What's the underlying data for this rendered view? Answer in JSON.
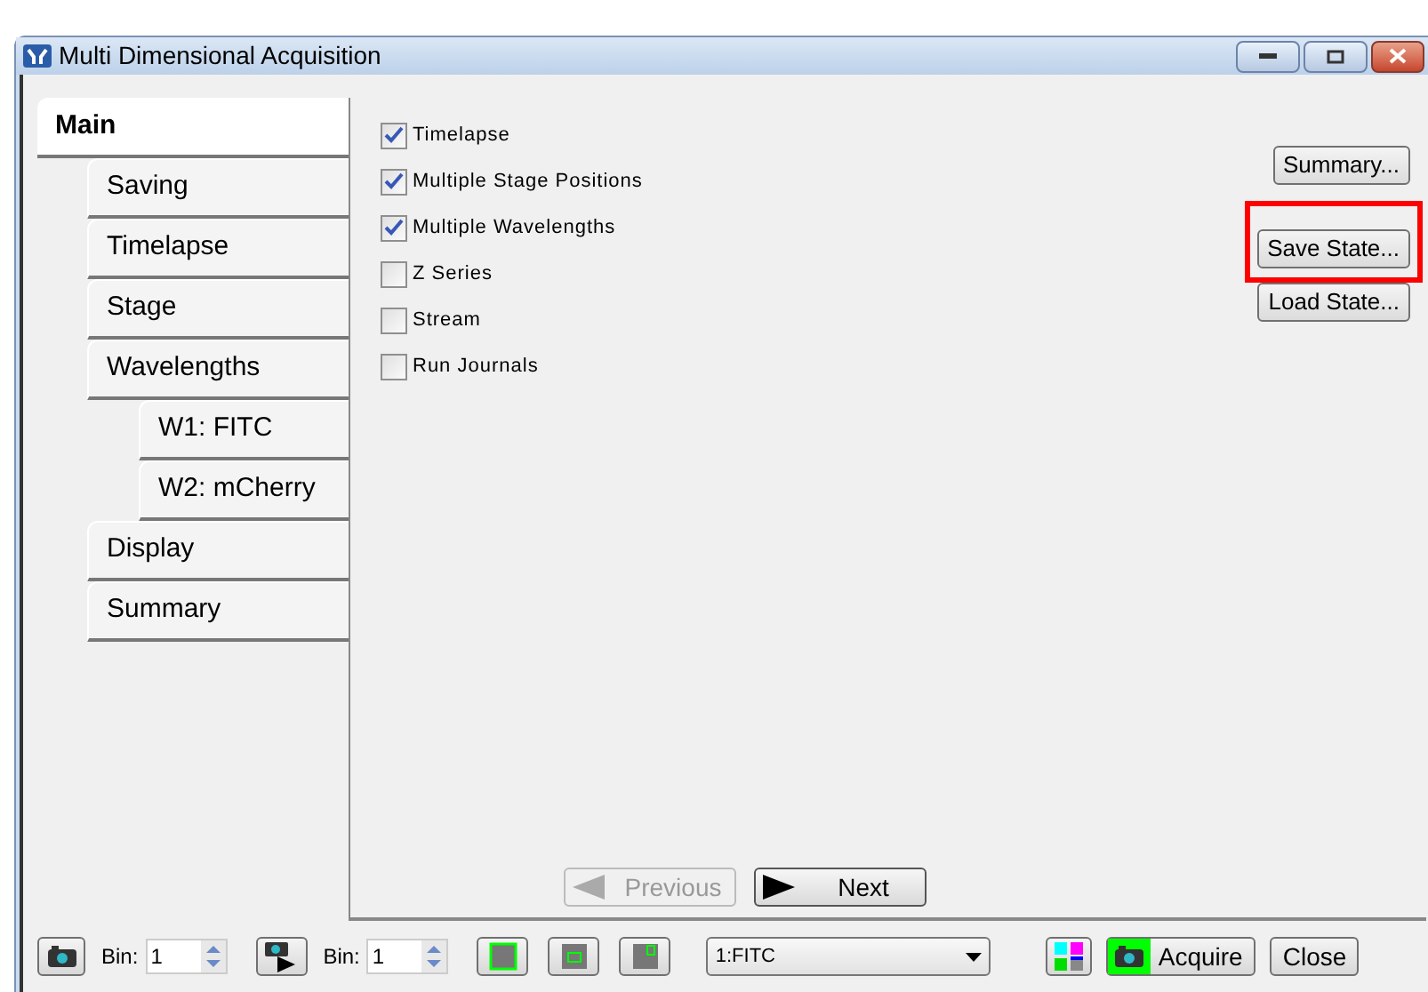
{
  "window": {
    "title": "Multi Dimensional Acquisition"
  },
  "sidebar": {
    "items": [
      {
        "label": "Main",
        "selected": true,
        "children": [
          {
            "label": "Saving",
            "selected": false
          },
          {
            "label": "Timelapse",
            "selected": false
          },
          {
            "label": "Stage",
            "selected": false
          },
          {
            "label": "Wavelengths",
            "selected": false,
            "children": [
              {
                "label": "W1: FITC",
                "selected": false
              },
              {
                "label": "W2: mCherry",
                "selected": false
              }
            ]
          },
          {
            "label": "Display",
            "selected": false
          },
          {
            "label": "Summary",
            "selected": false
          }
        ]
      }
    ]
  },
  "options": [
    {
      "label": "Timelapse",
      "checked": true
    },
    {
      "label": "Multiple Stage Positions",
      "checked": true
    },
    {
      "label": "Multiple Wavelengths",
      "checked": true
    },
    {
      "label": "Z Series",
      "checked": false
    },
    {
      "label": "Stream",
      "checked": false
    },
    {
      "label": "Run Journals",
      "checked": false
    }
  ],
  "side_buttons": [
    {
      "label": "Summary...",
      "highlighted": false
    },
    {
      "label": "Save State...",
      "highlighted": true
    },
    {
      "label": "Load State...",
      "highlighted": false
    }
  ],
  "nav_buttons": [
    {
      "kind": "previous",
      "label": "Previous",
      "disabled": true
    },
    {
      "kind": "next",
      "label": "Next",
      "disabled": false
    }
  ],
  "toolbar": {
    "bin_labels": [
      "Bin:",
      "Bin:"
    ],
    "bin_values": [
      "1",
      "1"
    ],
    "wavelength": "1:FITC",
    "acquire": "Acquire",
    "close": "Close"
  }
}
